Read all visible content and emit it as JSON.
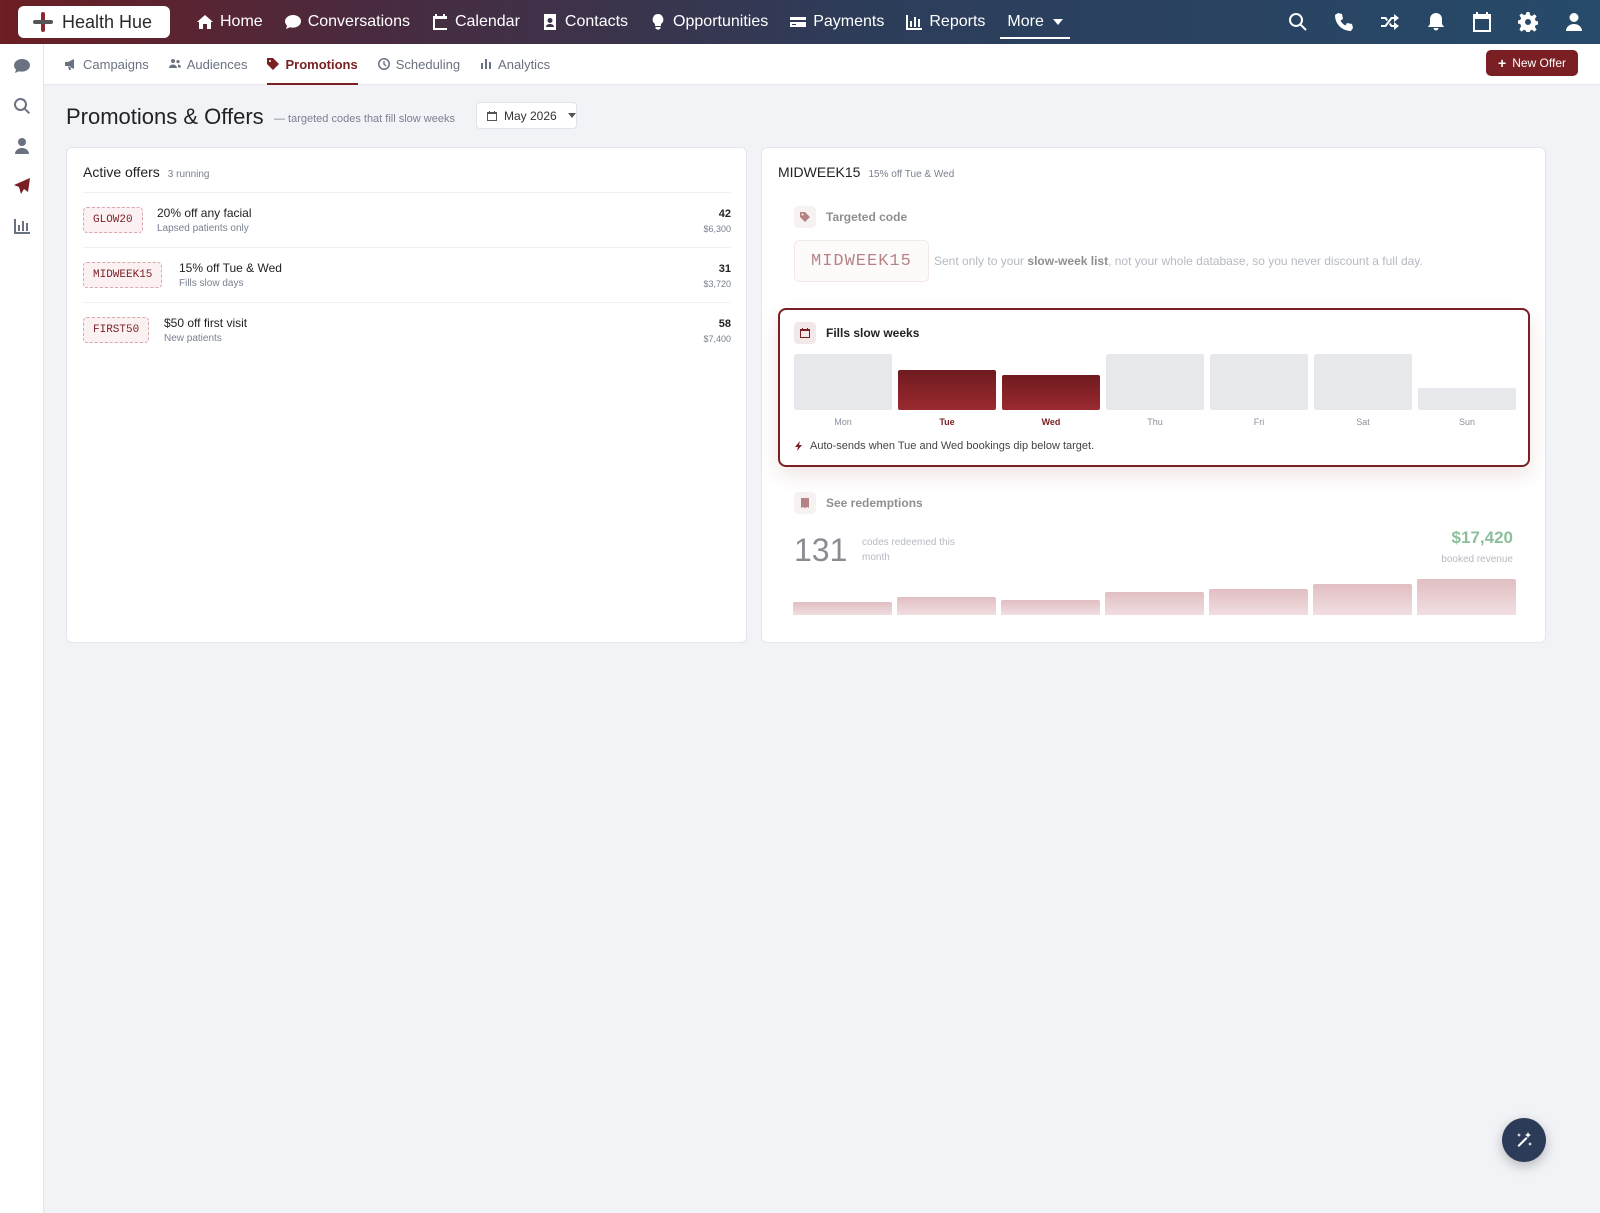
{
  "brand": {
    "name": "Health Hue"
  },
  "nav": {
    "items": [
      {
        "label": "Home",
        "icon": "home-icon"
      },
      {
        "label": "Conversations",
        "icon": "chat-icon"
      },
      {
        "label": "Calendar",
        "icon": "calendar-icon"
      },
      {
        "label": "Contacts",
        "icon": "contacts-icon"
      },
      {
        "label": "Opportunities",
        "icon": "lightbulb-icon"
      },
      {
        "label": "Payments",
        "icon": "credit-card-icon"
      },
      {
        "label": "Reports",
        "icon": "bar-chart-icon"
      }
    ],
    "more_label": "More"
  },
  "top_icons": [
    "search-icon",
    "phone-icon",
    "shuffle-icon",
    "bell-icon",
    "calendar-icon",
    "gear-icon",
    "user-icon"
  ],
  "sidebar_icons": [
    "chat-icon",
    "search-icon",
    "user-icon",
    "send-icon",
    "bar-chart-icon"
  ],
  "subnav": {
    "items": [
      {
        "label": "Campaigns",
        "icon": "megaphone-icon",
        "active": false
      },
      {
        "label": "Audiences",
        "icon": "users-icon",
        "active": false
      },
      {
        "label": "Promotions",
        "icon": "tag-icon",
        "active": true
      },
      {
        "label": "Scheduling",
        "icon": "clock-icon",
        "active": false
      },
      {
        "label": "Analytics",
        "icon": "bar-chart-icon",
        "active": false
      }
    ],
    "new_offer_label": "New Offer"
  },
  "page": {
    "title": "Promotions & Offers",
    "subtitle": "— targeted codes that fill slow weeks",
    "month": "May 2026"
  },
  "active_offers": {
    "title": "Active offers",
    "count_label": "3 running",
    "offers": [
      {
        "code": "GLOW20",
        "title": "20% off any facial",
        "audience": "Lapsed patients only",
        "redemptions": "42",
        "revenue": "$6,300"
      },
      {
        "code": "MIDWEEK15",
        "title": "15% off Tue & Wed",
        "audience": "Fills slow days",
        "redemptions": "31",
        "revenue": "$3,720"
      },
      {
        "code": "FIRST50",
        "title": "$50 off first visit",
        "audience": "New patients",
        "redemptions": "58",
        "revenue": "$7,400"
      }
    ]
  },
  "detail": {
    "code": "MIDWEEK15",
    "summary": "15% off Tue & Wed",
    "targeted": {
      "heading": "Targeted code",
      "code": "MIDWEEK15",
      "desc_pre": "Sent only to your ",
      "desc_bold": "slow-week list",
      "desc_post": ", not your whole database, so you never discount a full day."
    },
    "slow_weeks": {
      "heading": "Fills slow weeks",
      "note": "Auto-sends when Tue and Wed bookings dip below target.",
      "days": [
        {
          "label": "Mon",
          "level": 1.0,
          "highlight": false
        },
        {
          "label": "Tue",
          "level": 0.72,
          "highlight": true
        },
        {
          "label": "Wed",
          "level": 0.63,
          "highlight": true
        },
        {
          "label": "Thu",
          "level": 1.0,
          "highlight": false
        },
        {
          "label": "Fri",
          "level": 1.0,
          "highlight": false
        },
        {
          "label": "Sat",
          "level": 1.0,
          "highlight": false
        },
        {
          "label": "Sun",
          "level": 0.4,
          "highlight": false
        }
      ]
    },
    "redemptions": {
      "heading": "See redemptions",
      "count": "131",
      "count_label": "codes redeemed this month",
      "revenue": "$17,420",
      "revenue_label": "booked revenue",
      "trend": [
        0.36,
        0.5,
        0.42,
        0.64,
        0.72,
        0.86,
        1.0
      ]
    }
  },
  "colors": {
    "accent": "#7a1f24",
    "revenue": "#2f8a4a"
  }
}
